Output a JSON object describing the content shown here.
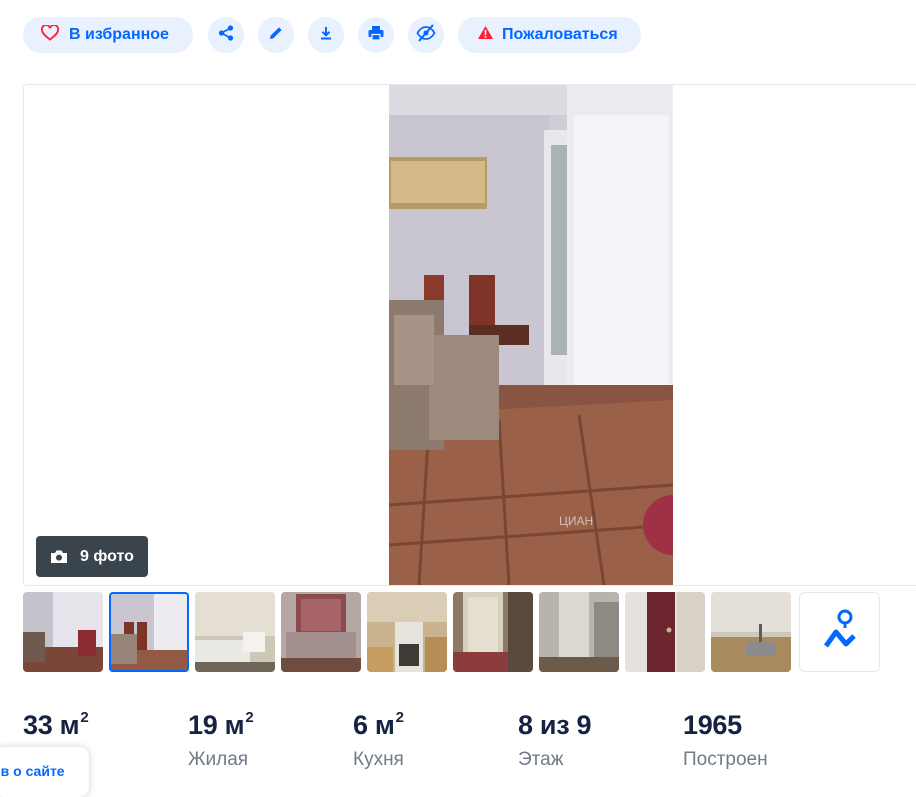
{
  "toolbar": {
    "favorite_label": "В избранное",
    "report_label": "Пожаловаться",
    "icons": [
      "heart-icon",
      "share-icon",
      "pencil-icon",
      "download-icon",
      "print-icon",
      "hide-icon",
      "warning-icon"
    ]
  },
  "gallery": {
    "photo_count_label": "9 фото",
    "watermark": "ЦИАН",
    "active_thumb_index": 1,
    "thumbnails": [
      {
        "name": "photo-1"
      },
      {
        "name": "photo-2"
      },
      {
        "name": "photo-3"
      },
      {
        "name": "photo-4"
      },
      {
        "name": "photo-5"
      },
      {
        "name": "photo-6"
      },
      {
        "name": "photo-7"
      },
      {
        "name": "photo-8"
      },
      {
        "name": "photo-9"
      }
    ]
  },
  "facts": [
    {
      "value": "33 м",
      "sup": "2",
      "label": ""
    },
    {
      "value": "19 м",
      "sup": "2",
      "label": "Жилая"
    },
    {
      "value": "6 м",
      "sup": "2",
      "label": "Кухня"
    },
    {
      "value": "8 из 9",
      "sup": "",
      "label": "Этаж"
    },
    {
      "value": "1965",
      "sup": "",
      "label": "Построен"
    }
  ],
  "feedback": {
    "label": "Отзыв о сайте"
  },
  "colors": {
    "accent": "#0468ff",
    "pill_bg": "#e8f1fd",
    "warning": "#ff1f34",
    "counter_bg": "#3a444c"
  }
}
